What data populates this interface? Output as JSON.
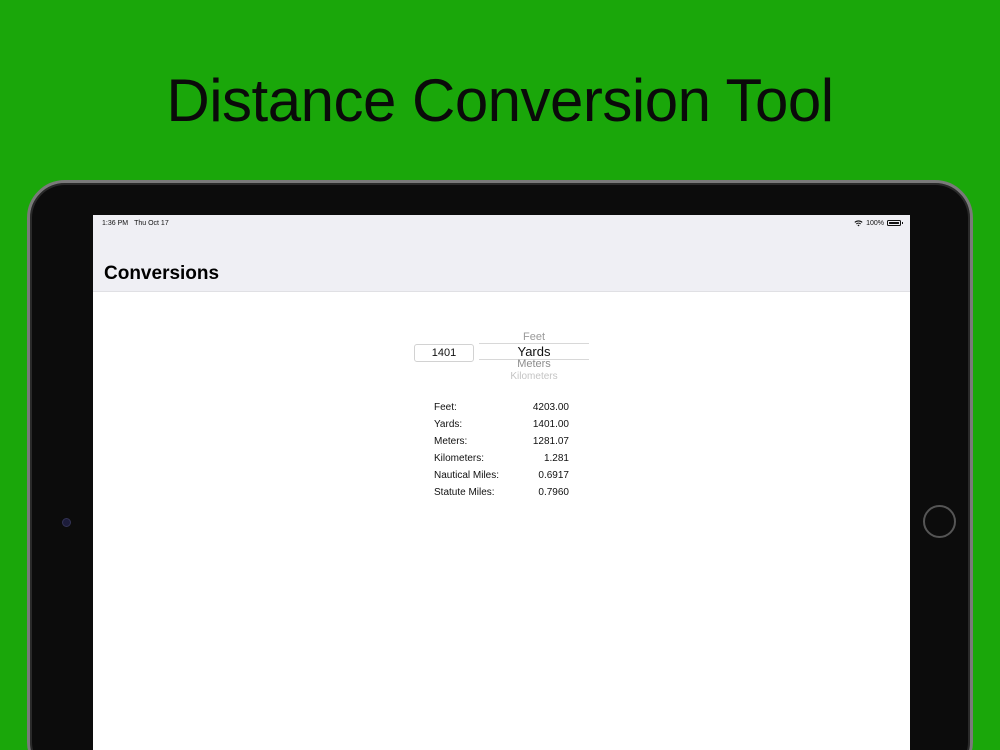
{
  "headline": "Distance Conversion Tool",
  "status_bar": {
    "time": "1:36 PM",
    "date": "Thu Oct 17",
    "battery": "100%"
  },
  "nav": {
    "title": "Conversions"
  },
  "input": {
    "value": "1401"
  },
  "picker": {
    "options": [
      "Feet",
      "Yards",
      "Meters",
      "Kilometers"
    ],
    "selected": "Yards"
  },
  "results": [
    {
      "label": "Feet:",
      "value": "4203.00"
    },
    {
      "label": "Yards:",
      "value": "1401.00"
    },
    {
      "label": "Meters:",
      "value": "1281.07"
    },
    {
      "label": "Kilometers:",
      "value": "1.281"
    },
    {
      "label": "Nautical Miles:",
      "value": "0.6917"
    },
    {
      "label": "Statute Miles:",
      "value": "0.7960"
    }
  ],
  "colors": {
    "background": "#1aa70a",
    "navbar": "#efeff4"
  }
}
